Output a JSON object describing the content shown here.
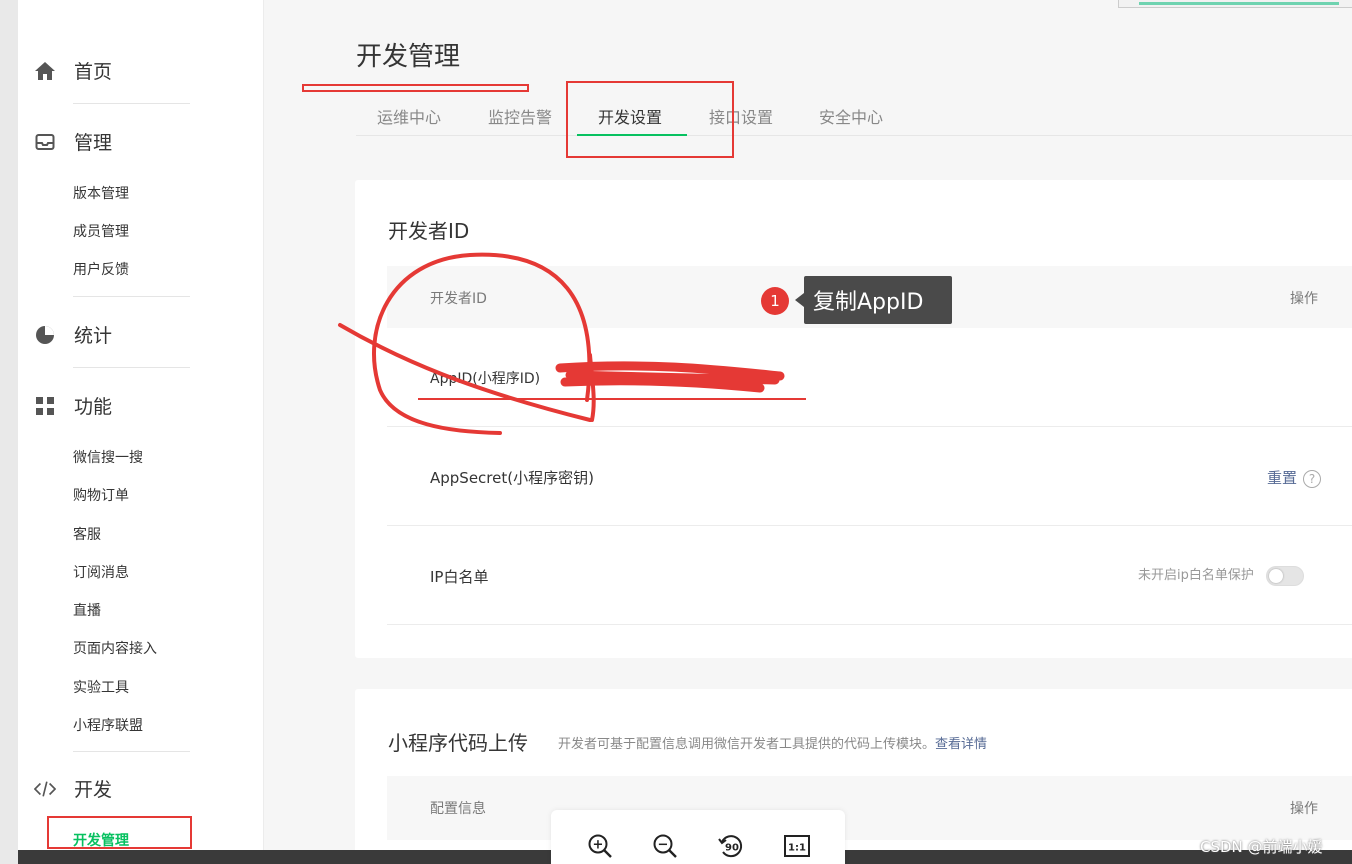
{
  "sidebar": {
    "home": "首页",
    "manage": "管理",
    "manage_items": [
      "版本管理",
      "成员管理",
      "用户反馈"
    ],
    "stats": "统计",
    "features": "功能",
    "feature_items": [
      "微信搜一搜",
      "购物订单",
      "客服",
      "订阅消息",
      "直播",
      "页面内容接入",
      "实验工具",
      "小程序联盟"
    ],
    "develop": "开发",
    "develop_items": [
      "开发管理"
    ]
  },
  "main": {
    "page_title": "开发管理",
    "tabs": [
      "运维中心",
      "监控告警",
      "开发设置",
      "接口设置",
      "安全中心"
    ],
    "active_tab": "开发设置",
    "developer_id_card": {
      "title": "开发者ID",
      "header": {
        "col1": "开发者ID",
        "col2": "操作"
      },
      "rows": [
        {
          "label": "AppID(小程序ID)"
        },
        {
          "label": "AppSecret(小程序密钥)",
          "action": "重置",
          "help": "?"
        },
        {
          "label": "IP白名单",
          "status": "未开启ip白名单保护"
        }
      ]
    },
    "upload_card": {
      "title": "小程序代码上传",
      "description": "开发者可基于配置信息调用微信开发者工具提供的代码上传模块。",
      "link": "查看详情",
      "header": {
        "col1": "配置信息",
        "col2": "操作"
      }
    }
  },
  "tooltip": {
    "badge": "1",
    "text": "复制AppID"
  },
  "viewer": {
    "zoom_in": "+",
    "zoom_out": "−",
    "rotate": "90",
    "actual": "1:1"
  },
  "watermark": "CSDN @前端小媛",
  "colors": {
    "accent_green": "#07c160",
    "link_blue": "#576b95",
    "annotation_red": "#e53935"
  }
}
